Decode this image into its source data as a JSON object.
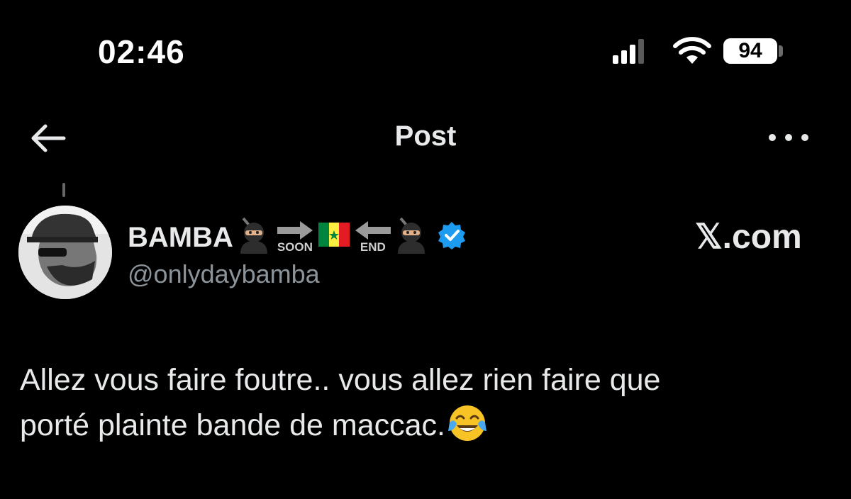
{
  "status_bar": {
    "time": "02:46",
    "battery": "94",
    "icons": [
      "signal-bars-icon",
      "wifi-icon",
      "battery-icon"
    ]
  },
  "nav": {
    "title": "Post",
    "back_icon": "arrow-left-icon",
    "more_icon": "more-horizontal-icon"
  },
  "post": {
    "author_name": "BAMBA",
    "name_emojis": [
      "ninja",
      "soon-arrow",
      "senegal-flag",
      "end-arrow",
      "ninja"
    ],
    "soon_caption": "SOON",
    "end_caption": "END",
    "verified": true,
    "handle": "@onlydaybamba",
    "site": "𝕏.com",
    "text_line1": "Allez vous faire foutre.. vous allez rien faire que",
    "text_line2": "porté plainte bande de maccac.",
    "trailing_emoji": "face-with-tears-of-joy"
  },
  "colors": {
    "background": "#000000",
    "text": "#e7e9ea",
    "secondary_text": "#8b949b",
    "verified_blue": "#1d9bf0"
  }
}
